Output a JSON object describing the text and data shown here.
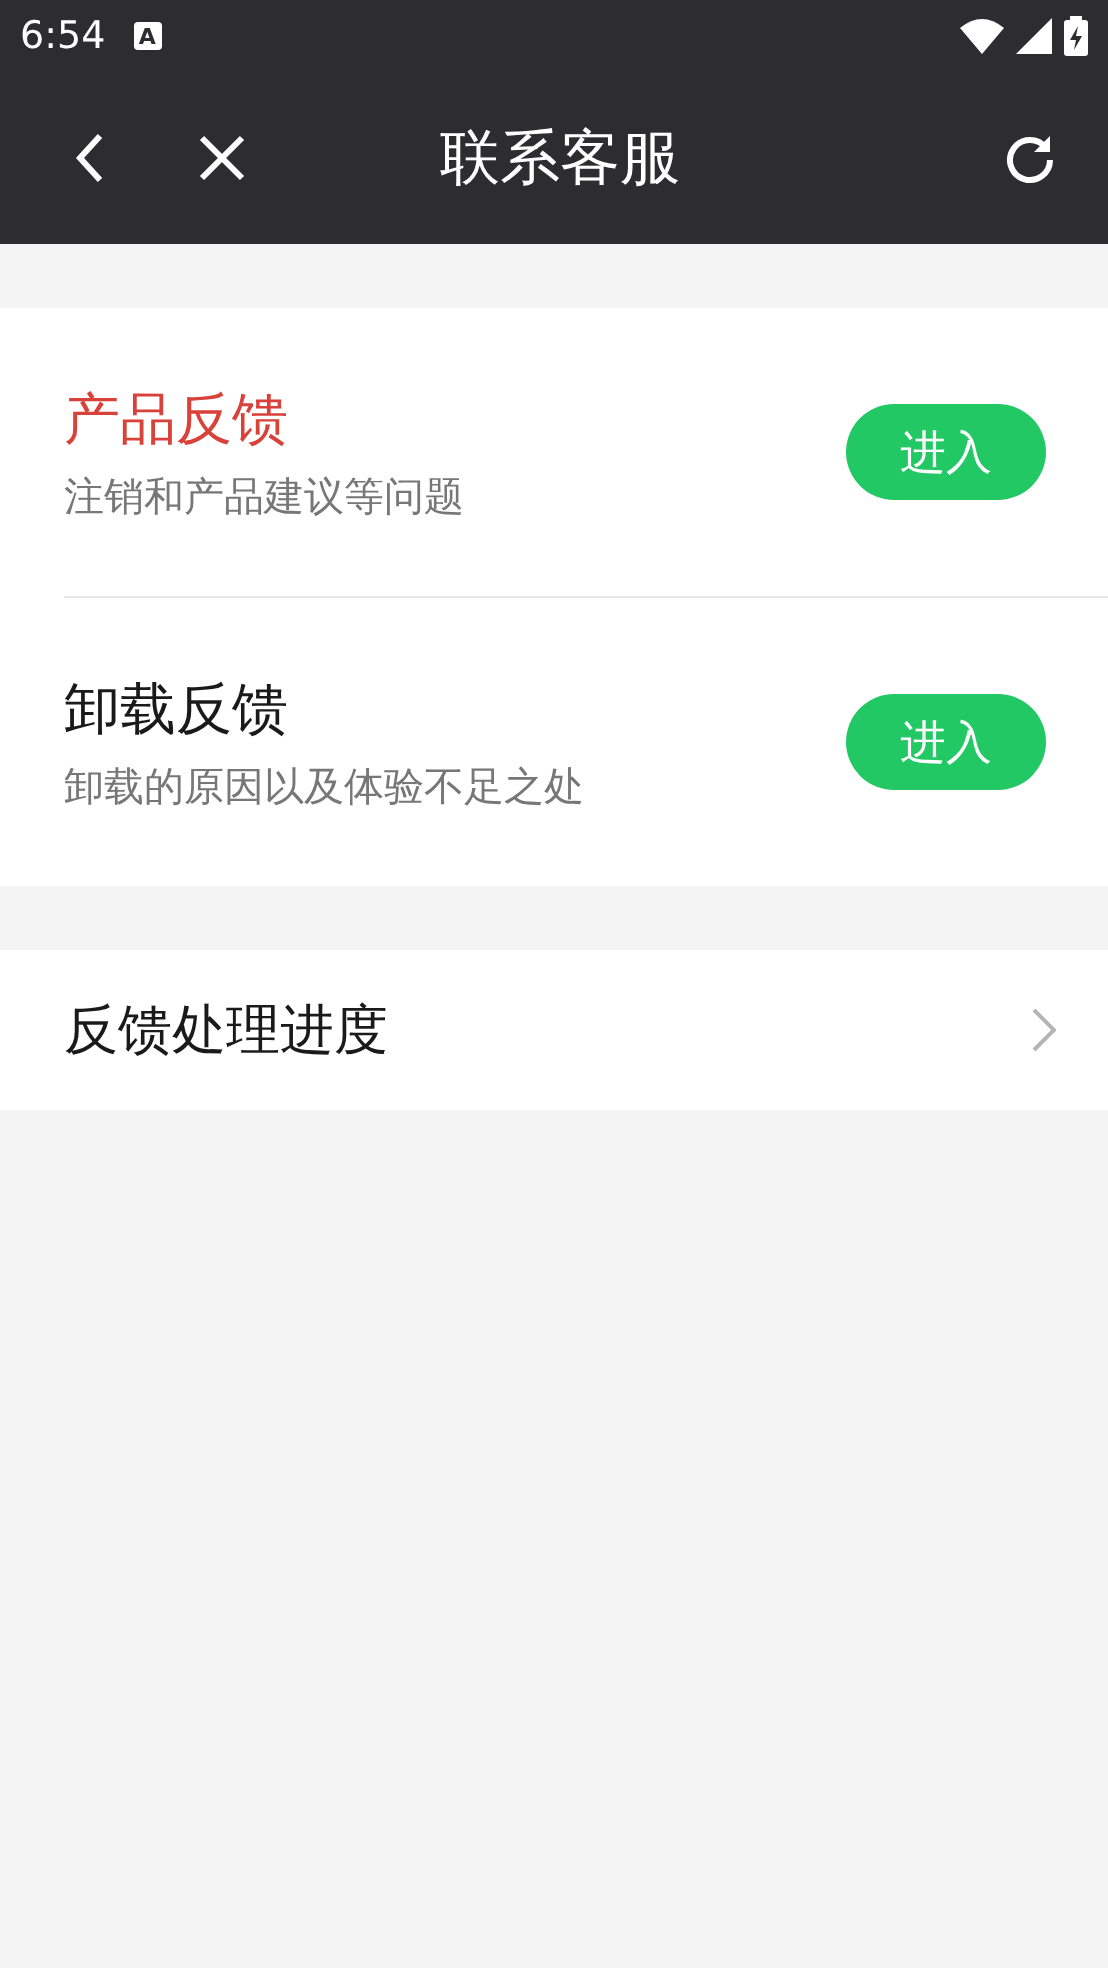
{
  "status_bar": {
    "time": "6:54",
    "notification": "A"
  },
  "header": {
    "title": "联系客服"
  },
  "feedback_items": [
    {
      "title": "产品反馈",
      "subtitle": "注销和产品建议等问题",
      "highlighted": true,
      "button": "进入"
    },
    {
      "title": "卸载反馈",
      "subtitle": "卸载的原因以及体验不足之处",
      "highlighted": false,
      "button": "进入"
    }
  ],
  "progress_link": {
    "label": "反馈处理进度"
  }
}
